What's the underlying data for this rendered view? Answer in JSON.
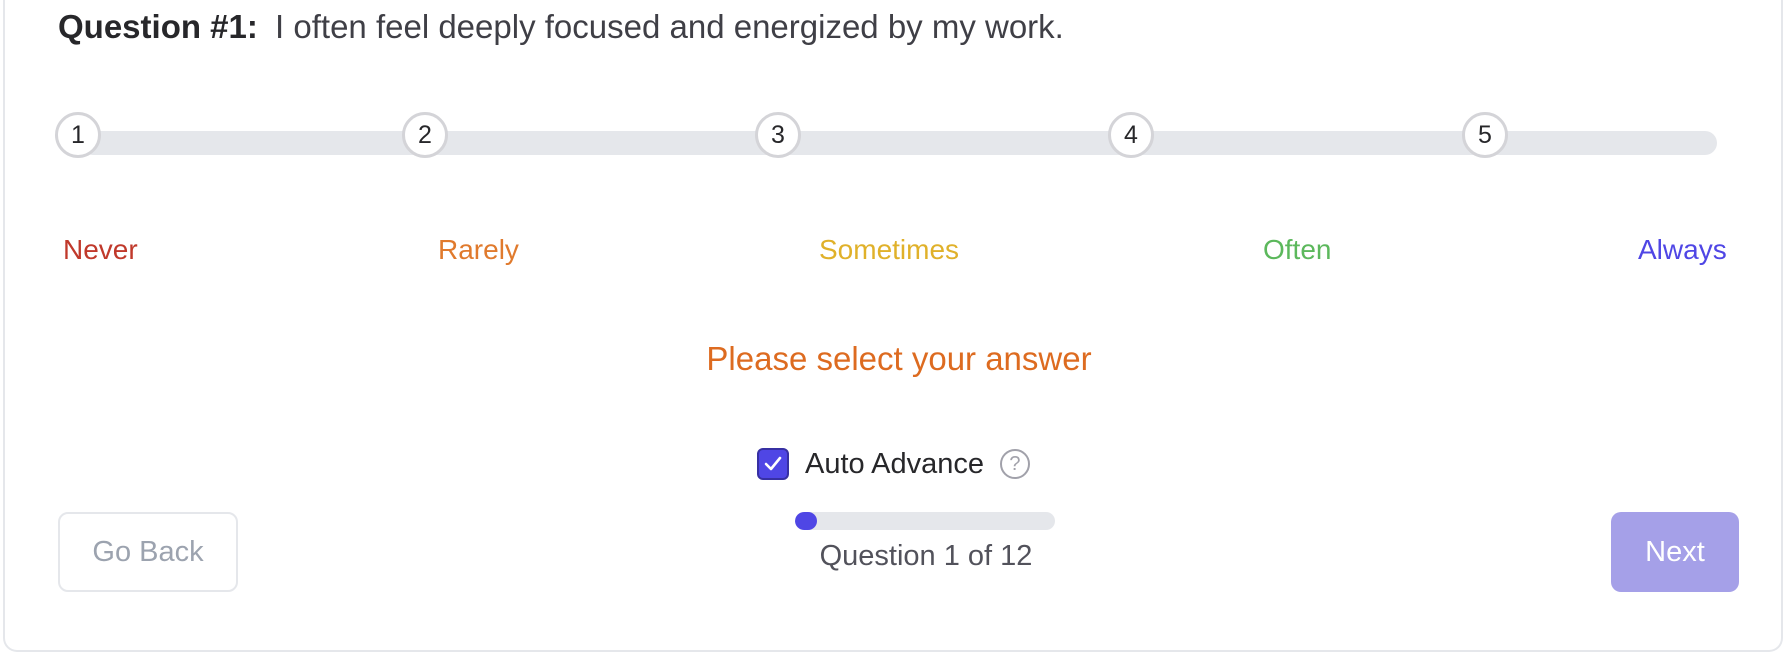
{
  "question": {
    "number_label": "Question #1:",
    "text": "I often feel deeply focused and energized by my work."
  },
  "scale": {
    "steps": [
      "1",
      "2",
      "3",
      "4",
      "5"
    ],
    "labels": [
      {
        "text": "Never",
        "color": "#c0392b"
      },
      {
        "text": "Rarely",
        "color": "#e07a2d"
      },
      {
        "text": "Sometimes",
        "color": "#e0b12a"
      },
      {
        "text": "Often",
        "color": "#5cb85c"
      },
      {
        "text": "Always",
        "color": "#4f46e5"
      }
    ]
  },
  "prompt": {
    "text": "Please select your answer",
    "color": "#dd6b20"
  },
  "auto_advance": {
    "label": "Auto Advance",
    "checked": true,
    "checkbox_color": "#4f46e5",
    "help_icon": "question-circle-icon"
  },
  "progress": {
    "text": "Question 1 of 12",
    "current": 1,
    "total": 12,
    "fill_color": "#4f46e5"
  },
  "buttons": {
    "back_label": "Go Back",
    "next_label": "Next",
    "next_color": "#a5a0e8"
  }
}
